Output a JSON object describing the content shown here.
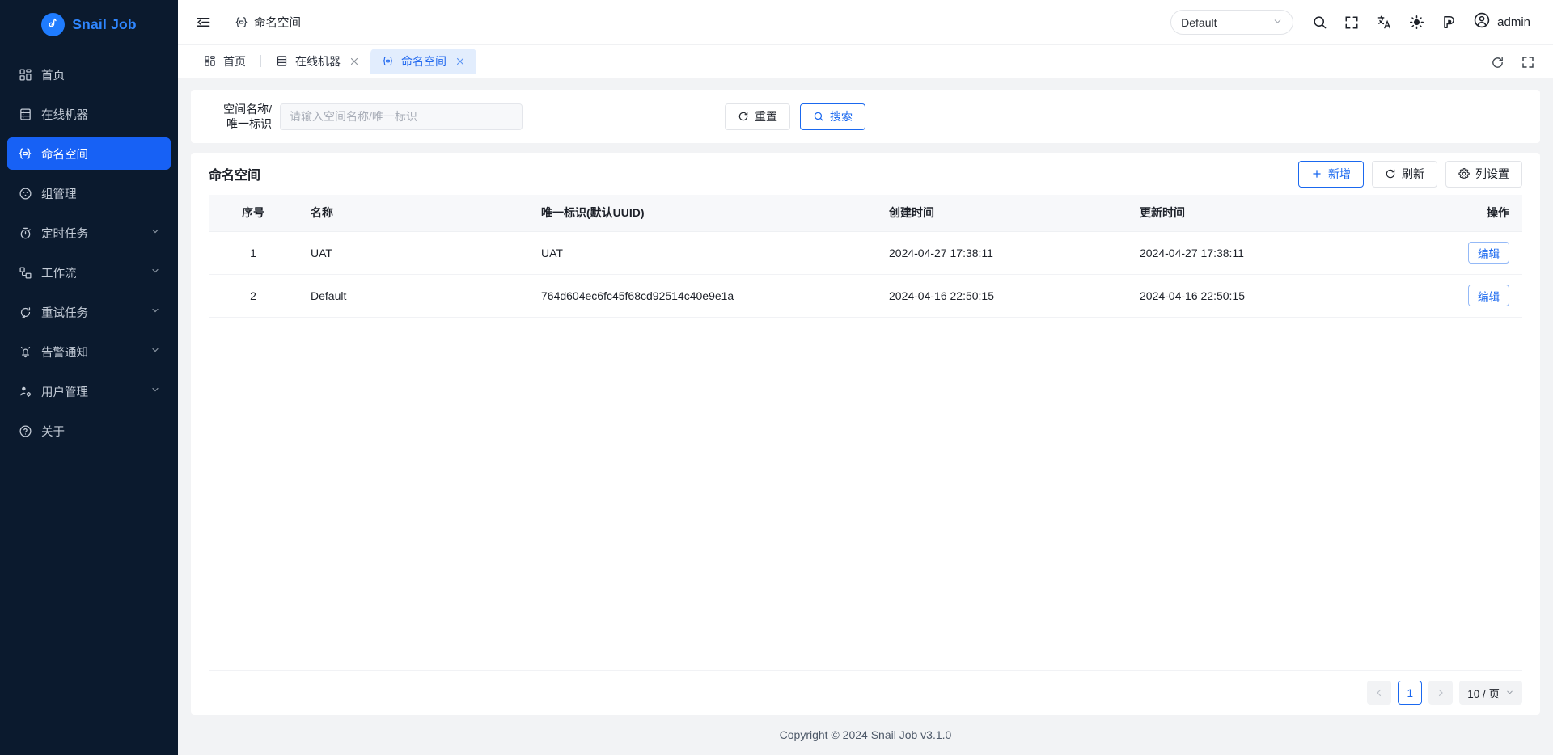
{
  "brand": {
    "name": "Snail Job",
    "logo_icon": "snail-logo-icon"
  },
  "sidebar": {
    "items": [
      {
        "label": "首页",
        "icon": "dashboard-icon",
        "expandable": false,
        "active": false
      },
      {
        "label": "在线机器",
        "icon": "server-icon",
        "expandable": false,
        "active": false
      },
      {
        "label": "命名空间",
        "icon": "namespace-icon",
        "expandable": false,
        "active": true
      },
      {
        "label": "组管理",
        "icon": "group-icon",
        "expandable": false,
        "active": false
      },
      {
        "label": "定时任务",
        "icon": "timer-icon",
        "expandable": true,
        "active": false
      },
      {
        "label": "工作流",
        "icon": "workflow-icon",
        "expandable": true,
        "active": false
      },
      {
        "label": "重试任务",
        "icon": "retry-icon",
        "expandable": true,
        "active": false
      },
      {
        "label": "告警通知",
        "icon": "bell-icon",
        "expandable": true,
        "active": false
      },
      {
        "label": "用户管理",
        "icon": "user-settings-icon",
        "expandable": true,
        "active": false
      },
      {
        "label": "关于",
        "icon": "question-icon",
        "expandable": false,
        "active": false
      }
    ]
  },
  "topbar": {
    "collapse_icon": "menu-collapse-icon",
    "breadcrumb": {
      "icon": "namespace-icon",
      "label": "命名空间"
    },
    "namespace_select": {
      "value": "Default",
      "icon": "chevron-down-icon"
    },
    "icons": [
      {
        "name": "search-icon"
      },
      {
        "name": "fullscreen-icon"
      },
      {
        "name": "translate-icon"
      },
      {
        "name": "theme-sun-icon"
      },
      {
        "name": "color-palette-icon"
      }
    ],
    "user": {
      "name": "admin",
      "avatar_icon": "user-circle-icon"
    }
  },
  "tabbar": {
    "tabs": [
      {
        "label": "首页",
        "icon": "dashboard-icon",
        "closable": false,
        "active": false
      },
      {
        "label": "在线机器",
        "icon": "server-icon",
        "closable": true,
        "active": false
      },
      {
        "label": "命名空间",
        "icon": "namespace-icon",
        "closable": true,
        "active": true
      }
    ],
    "refresh_icon": "refresh-icon",
    "expand_icon": "fullscreen-icon"
  },
  "search": {
    "field_label": "空间名称/\n唯一标识",
    "placeholder": "请输入空间名称/唯一标识",
    "value": "",
    "reset_label": "重置",
    "reset_icon": "refresh-icon",
    "search_label": "搜索",
    "search_icon": "search-icon"
  },
  "panel": {
    "title": "命名空间",
    "actions": [
      {
        "label": "新增",
        "icon": "plus-icon",
        "style": "primary-outline"
      },
      {
        "label": "刷新",
        "icon": "refresh-icon",
        "style": "default"
      },
      {
        "label": "列设置",
        "icon": "gear-icon",
        "style": "default"
      }
    ]
  },
  "table": {
    "columns": [
      "序号",
      "名称",
      "唯一标识(默认UUID)",
      "创建时间",
      "更新时间",
      "操作"
    ],
    "rows": [
      {
        "index": "1",
        "name": "UAT",
        "uuid": "UAT",
        "created_at": "2024-04-27 17:38:11",
        "updated_at": "2024-04-27 17:38:11",
        "action_label": "编辑"
      },
      {
        "index": "2",
        "name": "Default",
        "uuid": "764d604ec6fc45f68cd92514c40e9e1a",
        "created_at": "2024-04-16 22:50:15",
        "updated_at": "2024-04-16 22:50:15",
        "action_label": "编辑"
      }
    ]
  },
  "pagination": {
    "prev_icon": "chevron-left-icon",
    "next_icon": "chevron-right-icon",
    "current_page": "1",
    "page_size_label": "10 / 页",
    "page_size_icon": "chevron-down-icon"
  },
  "footer": {
    "text": "Copyright © 2024 Snail Job v3.1.0"
  },
  "colors": {
    "sidebar_bg": "#0b1a2e",
    "accent": "#1761f5",
    "brand_text": "#2f86ff",
    "tab_active_bg": "#e2edfd",
    "tab_active_text": "#2269ef",
    "page_bg": "#f2f3f5",
    "link": "#1a68ef"
  }
}
